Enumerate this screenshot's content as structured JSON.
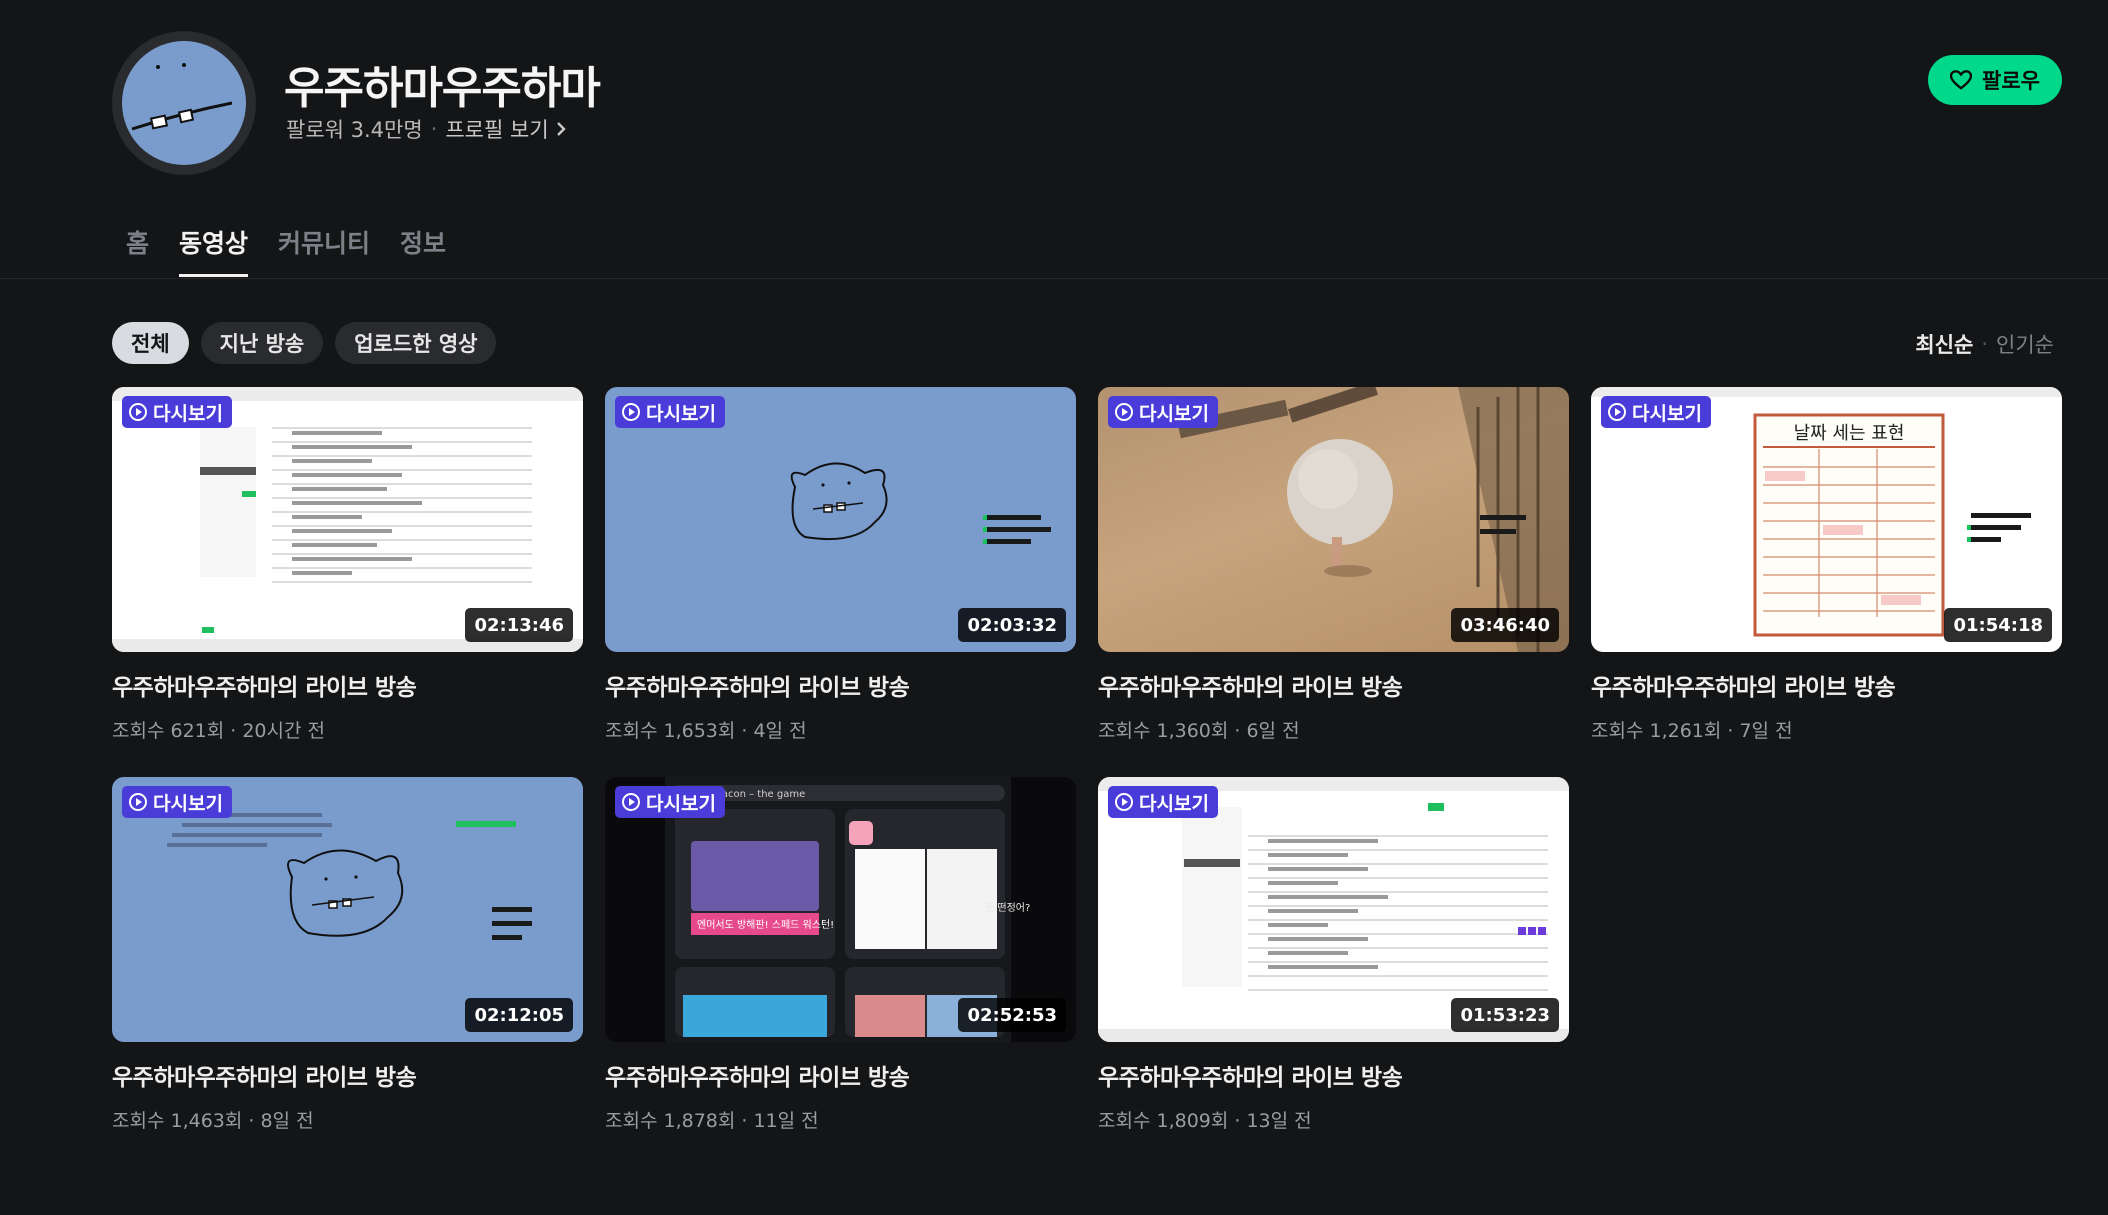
{
  "channel": {
    "name": "우주하마우주하마",
    "followers": "팔로워 3.4만명",
    "profile_link": "프로필 보기",
    "follow_label": "팔로우"
  },
  "tabs": [
    {
      "label": "홈",
      "active": false
    },
    {
      "label": "동영상",
      "active": true
    },
    {
      "label": "커뮤니티",
      "active": false
    },
    {
      "label": "정보",
      "active": false
    }
  ],
  "filters": [
    {
      "label": "전체",
      "active": true
    },
    {
      "label": "지난 방송",
      "active": false
    },
    {
      "label": "업로드한 영상",
      "active": false
    }
  ],
  "sort": {
    "latest": "최신순",
    "popular": "인기순"
  },
  "badge_label": "다시보기",
  "colors": {
    "accent": "#00d98c",
    "badge": "#4a3cd9",
    "avatar_bg": "#7a9ccd",
    "background": "#141517"
  },
  "videos": [
    {
      "title": "우주하마우주하마의 라이브 방송",
      "meta": "조회수 621회 · 20시간 전",
      "duration": "02:13:46"
    },
    {
      "title": "우주하마우주하마의 라이브 방송",
      "meta": "조회수 1,653회 · 4일 전",
      "duration": "02:03:32"
    },
    {
      "title": "우주하마우주하마의 라이브 방송",
      "meta": "조회수 1,360회 · 6일 전",
      "duration": "03:46:40"
    },
    {
      "title": "우주하마우주하마의 라이브 방송",
      "meta": "조회수 1,261회 · 7일 전",
      "duration": "01:54:18"
    },
    {
      "title": "우주하마우주하마의 라이브 방송",
      "meta": "조회수 1,463회 · 8일 전",
      "duration": "02:12:05"
    },
    {
      "title": "우주하마우주하마의 라이브 방송",
      "meta": "조회수 1,878회 · 11일 전",
      "duration": "02:52:53"
    },
    {
      "title": "우주하마우주하마의 라이브 방송",
      "meta": "조회수 1,809회 · 13일 전",
      "duration": "01:53:23"
    }
  ],
  "thumb_text": {
    "calendar_title": "날짜 세는 표현",
    "game_search": "Bacon – the game",
    "game_banner": "엔머서도 방해판! 스페드 워스턴!",
    "chat_1": "존 떤정어?"
  }
}
